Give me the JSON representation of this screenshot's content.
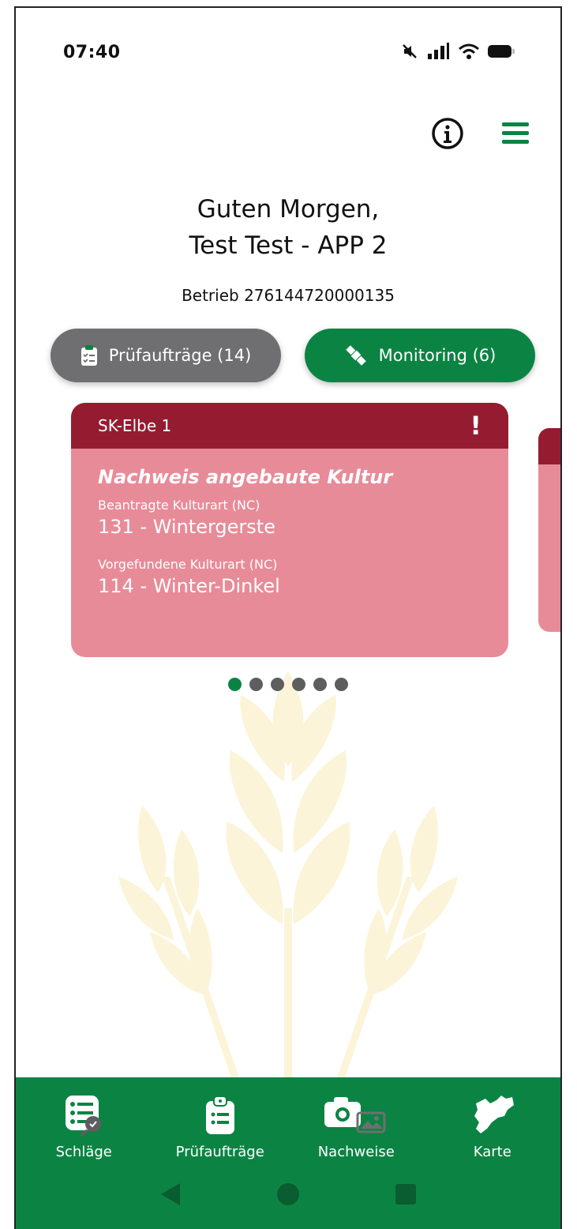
{
  "status_bar": {
    "time": "07:40"
  },
  "greeting": {
    "line1": "Guten Morgen,",
    "line2": "Test Test - APP 2"
  },
  "betrieb": "Betrieb 276144720000135",
  "segments": {
    "pruefauftraege": "Prüfaufträge (14)",
    "monitoring": "Monitoring (6)"
  },
  "card": {
    "header": "SK-Elbe 1",
    "alert": "!",
    "title": "Nachweis angebaute Kultur",
    "requested_label": "Beantragte Kulturart (NC)",
    "requested_value": "131 - Wintergerste",
    "found_label": "Vorgefundene Kulturart (NC)",
    "found_value": "114 - Winter-Dinkel"
  },
  "pagination": {
    "count": 6,
    "active": 1
  },
  "nav": {
    "items": [
      {
        "label": "Schläge",
        "icon": "fields-list-icon"
      },
      {
        "label": "Prüfaufträge",
        "icon": "clipboard-icon"
      },
      {
        "label": "Nachweise",
        "icon": "camera-gallery-icon"
      },
      {
        "label": "Karte",
        "icon": "saxony-map-icon"
      }
    ]
  },
  "colors": {
    "green": "#0b8443",
    "grey": "#6f6f72",
    "card_header": "#951c30",
    "card_body": "#e88b98",
    "wheat": "#fbf4d8"
  }
}
